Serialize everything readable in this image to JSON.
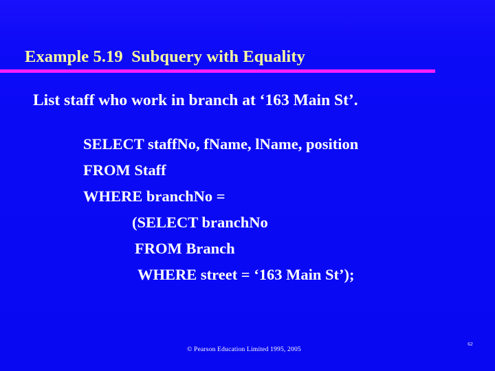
{
  "slide": {
    "background_color": "#0a0af4",
    "title": "Example 5.19  Subquery with Equality",
    "title_color": "#ffff9e",
    "rule_color": "#fb1ffb",
    "question": "List staff who work in branch at ‘163 Main St’.",
    "body_text_color": "#ffffff"
  },
  "sql": {
    "lines": [
      {
        "text": "SELECT staffNo, fName, lName, position",
        "indent": 0
      },
      {
        "text": "FROM Staff",
        "indent": 0
      },
      {
        "text": "WHERE branchNo =",
        "indent": 0
      },
      {
        "text": "(SELECT branchNo",
        "indent": 1
      },
      {
        "text": "FROM Branch",
        "indent": 2
      },
      {
        "text": "WHERE street = ‘163 Main St’);",
        "indent": 3
      }
    ]
  },
  "footer": {
    "copyright": "© Pearson Education Limited 1995, 2005",
    "page_number": "62"
  }
}
